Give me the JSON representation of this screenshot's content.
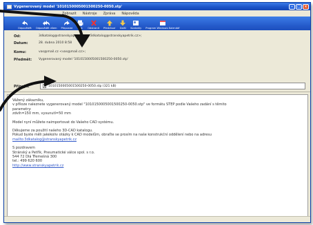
{
  "window": {
    "title": "Vygenerovaný model '1010150005001500250-0050.stp'"
  },
  "menu": [
    "Zobrazit",
    "Nástroje",
    "Zpráva",
    "Nápověda"
  ],
  "toolbar": [
    {
      "label": "Odpovědět",
      "icon": "reply-icon"
    },
    {
      "label": "Odpovědět všem",
      "icon": "reply-all-icon"
    },
    {
      "label": "Přeposlat",
      "icon": "forward-icon"
    },
    {
      "label": "Tisk",
      "icon": "print-icon"
    },
    {
      "label": "Odstranit",
      "icon": "delete-icon"
    },
    {
      "label": "Předchozí",
      "icon": "up-arrow-icon"
    },
    {
      "label": "Další",
      "icon": "down-arrow-icon"
    },
    {
      "label": "Kontakty",
      "icon": "contacts-icon"
    },
    {
      "label": "Program Windows Kalendář",
      "icon": "calendar-icon"
    }
  ],
  "headers": {
    "from_label": "Od:",
    "from_value": "3dkatalog@stranskyapetrik.cz <3dkatalog@stranskyapetrik.cz>;",
    "date_label": "Datum:",
    "date_value": "28. dubna 2010 8:58",
    "to_label": "Komu:",
    "to_value": "vas@mail.cz <vas@mail.cz>;",
    "subject_label": "Předmět:",
    "subject_value": "Vygenerovaný model '1010150005001500250-0050.stp'",
    "attach_label": "Přípojit:",
    "attach_value": "1010150005001500250-0050.stp (321 kB)"
  },
  "body": {
    "greeting": "Vážený zákazníku,",
    "p1_l1": "v příloze naleznete vygenerovaný model \"1010150005001500250-0050.stp\" ve formátu STEP podle Vašeho zadání s těmito",
    "p1_l2": "parametry:",
    "p1_l3": "zdvih=150 mm, vysunutí=50 mm",
    "p2": "Model nyní můžete naimportovat do Vašeho CAD systému.",
    "p3_l1": "Děkujeme za použití našeho 3D-CAD katalogu.",
    "p3_l2": "Pokud byste měli jakékoliv otázky k CAD modelům, obraťte se prosím na naše konstrukční oddělení nebo na adresu",
    "p3_link": "mailto:3dkatalog@stranskyapetrik.cz",
    "sig_l1": "S pozdravem",
    "sig_l2": "Stránský a Petřík, Pneumatické válce spol. s r.o.",
    "sig_l3": "544 72 Dlá Třemešná 300",
    "sig_l4": "tel.: 499 620 600",
    "sig_link": "http://www.stranskyapetrik.cz"
  },
  "colors": {
    "titlebar": "#1a52c7",
    "toolbar": "#2459c9",
    "link": "#3158c8",
    "chrome": "#ece9d8"
  }
}
